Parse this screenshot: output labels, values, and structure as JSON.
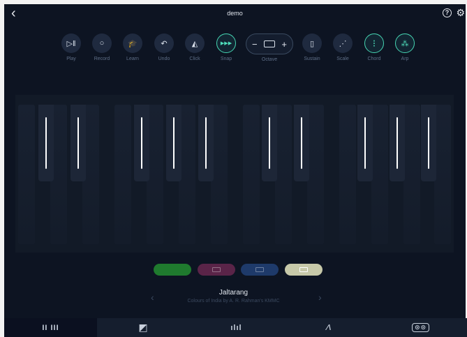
{
  "header": {
    "back_icon": "chevron-left-icon",
    "title": "demo",
    "help_icon": "question-circle-icon",
    "settings_icon": "gear-icon"
  },
  "toolbar": {
    "play": {
      "label": "Play",
      "glyph": "▷‖"
    },
    "record": {
      "label": "Record",
      "glyph": "○"
    },
    "learn": {
      "label": "Learn",
      "glyph": "🎓"
    },
    "undo": {
      "label": "Undo",
      "glyph": "↶"
    },
    "click": {
      "label": "Click",
      "glyph": "◭"
    },
    "snap": {
      "label": "Snap",
      "glyph": "▶▶▶"
    },
    "octave": {
      "label": "Octave",
      "minus": "−",
      "plus": "+"
    },
    "sustain": {
      "label": "Sustain",
      "glyph": "▯"
    },
    "scale": {
      "label": "Scale",
      "glyph": "⋰"
    },
    "chord": {
      "label": "Chord",
      "glyph": "⁝"
    },
    "arp": {
      "label": "Arp",
      "glyph": "⁂"
    }
  },
  "colors": {
    "accent": "#46d6b3",
    "background": "#0d1422",
    "swatch_green": "#1f7a2e",
    "swatch_magenta": "#5a2448",
    "swatch_blue": "#1e3a6a",
    "swatch_sand": "#c7c9a9"
  },
  "song": {
    "name": "Jaltarang",
    "subtitle": "Colours of India by A. R. Rahman's KMMC"
  },
  "tabs": [
    {
      "icon": "keyboard-icon",
      "glyph": "II III"
    },
    {
      "icon": "pad-icon",
      "glyph": "◩"
    },
    {
      "icon": "mixer-icon",
      "glyph": "ılıl"
    },
    {
      "icon": "envelope-icon",
      "glyph": "⁄\\"
    },
    {
      "icon": "tape-icon",
      "glyph": "⊙⊙"
    }
  ]
}
